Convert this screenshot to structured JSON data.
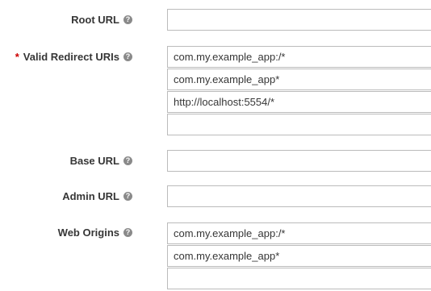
{
  "fields": {
    "root_url": {
      "label": "Root URL",
      "value": ""
    },
    "redirect_uris": {
      "required_mark": "*",
      "label": "Valid Redirect URIs",
      "values": [
        "com.my.example_app:/*",
        "com.my.example_app*",
        "http://localhost:5554/*",
        ""
      ]
    },
    "base_url": {
      "label": "Base URL",
      "value": ""
    },
    "admin_url": {
      "label": "Admin URL",
      "value": ""
    },
    "web_origins": {
      "label": "Web Origins",
      "values": [
        "com.my.example_app:/*",
        "com.my.example_app*",
        ""
      ]
    }
  },
  "help_glyph": "?"
}
